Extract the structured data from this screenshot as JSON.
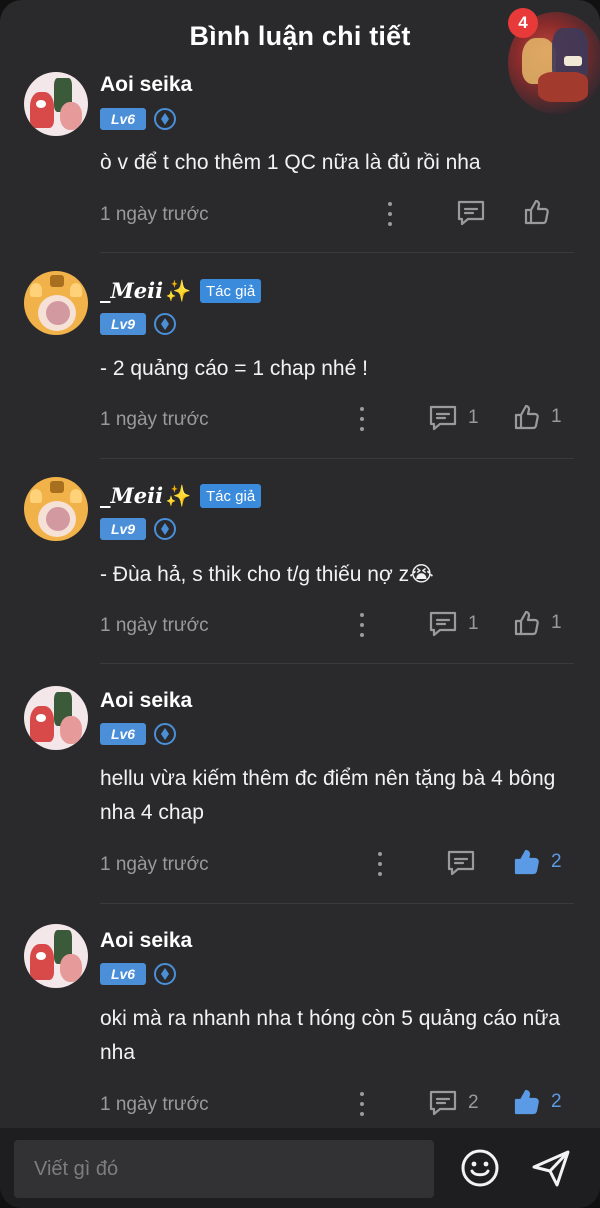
{
  "header": {
    "title": "Bình luận chi tiết",
    "notification_count": "4"
  },
  "comments": [
    {
      "user": "Aoi seika",
      "level": "Lv6",
      "is_author": false,
      "author_label": "",
      "text": "ò v để t cho thêm 1 QC nữa là đủ rồi nha",
      "time": "1 ngày trước",
      "replies": "",
      "likes": "",
      "liked": false
    },
    {
      "user": "_Meii",
      "level": "Lv9",
      "is_author": true,
      "author_label": "Tác giả",
      "text": "- 2 quảng cáo = 1 chap nhé !",
      "time": "1 ngày trước",
      "replies": "1",
      "likes": "1",
      "liked": false
    },
    {
      "user": "_Meii",
      "level": "Lv9",
      "is_author": true,
      "author_label": "Tác giả",
      "text": "- Đùa hả, s thik cho t/g thiếu nợ z😭",
      "time": "1 ngày trước",
      "replies": "1",
      "likes": "1",
      "liked": false
    },
    {
      "user": "Aoi seika",
      "level": "Lv6",
      "is_author": false,
      "author_label": "",
      "text": "hellu vừa kiếm thêm đc điểm nên tặng bà 4 bông nha 4 chap",
      "time": "1 ngày trước",
      "replies": "",
      "likes": "2",
      "liked": true
    },
    {
      "user": "Aoi seika",
      "level": "Lv6",
      "is_author": false,
      "author_label": "",
      "text": "oki mà ra nhanh nha t hóng còn 5 quảng cáo nữa nha",
      "time": "1 ngày trước",
      "replies": "2",
      "likes": "2",
      "liked": true
    }
  ],
  "composer": {
    "placeholder": "Viết gì đó",
    "emoji_icon": "emoji-icon",
    "send_icon": "send-icon"
  },
  "colors": {
    "background": "#2a2a2c",
    "accent": "#4a8fd8",
    "liked": "#5b9be6",
    "badge": "#e93a3a"
  }
}
